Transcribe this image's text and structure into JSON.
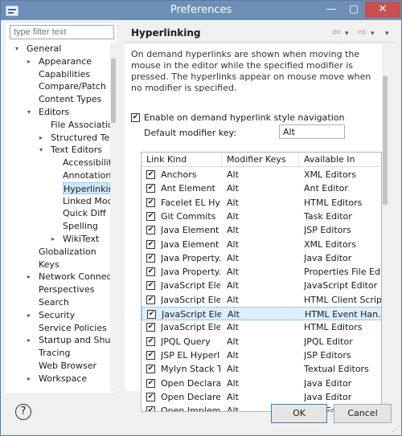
{
  "window": {
    "title": "Preferences",
    "min": "—",
    "max": "▢",
    "close": "✕"
  },
  "filter": {
    "placeholder": "type filter text"
  },
  "tree": [
    {
      "label": "General",
      "level": 0,
      "twisty": "▾"
    },
    {
      "label": "Appearance",
      "level": 1,
      "twisty": "▸"
    },
    {
      "label": "Capabilities",
      "level": 1
    },
    {
      "label": "Compare/Patch",
      "level": 1
    },
    {
      "label": "Content Types",
      "level": 1
    },
    {
      "label": "Editors",
      "level": 1,
      "twisty": "▾"
    },
    {
      "label": "File Associatio",
      "level": 2
    },
    {
      "label": "Structured Text",
      "level": 2,
      "twisty": "▸"
    },
    {
      "label": "Text Editors",
      "level": 2,
      "twisty": "▾"
    },
    {
      "label": "Accessibility",
      "level": 3
    },
    {
      "label": "Annotations",
      "level": 3
    },
    {
      "label": "Hyperlinking",
      "level": 3,
      "selected": true
    },
    {
      "label": "Linked Mod",
      "level": 3
    },
    {
      "label": "Quick Diff",
      "level": 3
    },
    {
      "label": "Spelling",
      "level": 3
    },
    {
      "label": "WikiText",
      "level": 3,
      "twisty": "▸"
    },
    {
      "label": "Globalization",
      "level": 1
    },
    {
      "label": "Keys",
      "level": 1
    },
    {
      "label": "Network Connectio",
      "level": 1,
      "twisty": "▸"
    },
    {
      "label": "Perspectives",
      "level": 1
    },
    {
      "label": "Search",
      "level": 1
    },
    {
      "label": "Security",
      "level": 1,
      "twisty": "▸"
    },
    {
      "label": "Service Policies",
      "level": 1
    },
    {
      "label": "Startup and Shutd",
      "level": 1,
      "twisty": "▸"
    },
    {
      "label": "Tracing",
      "level": 1
    },
    {
      "label": "Web Browser",
      "level": 1
    },
    {
      "label": "Workspace",
      "level": 1,
      "twisty": "▸"
    }
  ],
  "page": {
    "heading": "Hyperlinking",
    "back": "⇦",
    "back_menu": "▾",
    "fwd": "⇨",
    "fwd_menu": "▾",
    "menu": "▾",
    "description": "On demand hyperlinks are shown when moving the mouse in the editor while the specified modifier is pressed. The hyperlinks appear on mouse move when no modifier is specified.",
    "enable_label": "Enable on demand hyperlink style navigation",
    "enable_checked": "✔",
    "modifier_label": "Default modifier key:",
    "modifier_value": "Alt"
  },
  "table": {
    "headers": [
      "Link Kind",
      "Modifier Keys",
      "Available In"
    ],
    "rows": [
      {
        "kind": "Anchors",
        "mod": "Alt",
        "avail": "XML Editors"
      },
      {
        "kind": "Ant Element",
        "mod": "Alt",
        "avail": "Ant Editor"
      },
      {
        "kind": "Facelet EL Hy...",
        "mod": "Alt",
        "avail": "HTML Editors"
      },
      {
        "kind": "Git Commits",
        "mod": "Alt",
        "avail": "Task Editor"
      },
      {
        "kind": "Java Element",
        "mod": "Alt",
        "avail": "JSP Editors"
      },
      {
        "kind": "Java Element",
        "mod": "Alt",
        "avail": "XML Editors"
      },
      {
        "kind": "Java Property...",
        "mod": "Alt",
        "avail": "Java Editor"
      },
      {
        "kind": "Java Property...",
        "mod": "Alt",
        "avail": "Properties File Ed..."
      },
      {
        "kind": "JavaScript Ele...",
        "mod": "Alt",
        "avail": "JavaScript Editor"
      },
      {
        "kind": "JavaScript Ele...",
        "mod": "Alt",
        "avail": "HTML Client Script"
      },
      {
        "kind": "JavaScript Ele...",
        "mod": "Alt",
        "avail": "HTML Event Han...",
        "selected": true
      },
      {
        "kind": "JavaScript Ele...",
        "mod": "Alt",
        "avail": "HTML Editors"
      },
      {
        "kind": "JPQL Query",
        "mod": "Alt",
        "avail": "JPQL Editor"
      },
      {
        "kind": "JSP EL Hyperli...",
        "mod": "Alt",
        "avail": "JSP Editors"
      },
      {
        "kind": "Mylyn Stack T...",
        "mod": "Alt",
        "avail": "Textual Editors"
      },
      {
        "kind": "Open Declara...",
        "mod": "Alt",
        "avail": "Java Editor"
      },
      {
        "kind": "Open Declare...",
        "mod": "Alt",
        "avail": "Java Editor"
      },
      {
        "kind": "Open Implem...",
        "mod": "Alt",
        "avail": "Java Editor"
      }
    ],
    "check": "✔"
  },
  "buttons": {
    "help": "?",
    "ok": "OK",
    "cancel": "Cancel"
  }
}
